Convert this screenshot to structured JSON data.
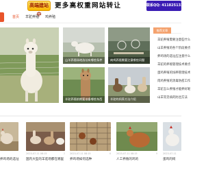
{
  "banner": {
    "tag": "高端建站中",
    "slogan": "更多高权重网站转让",
    "qq": "联系QQ: 411825133"
  },
  "nav": {
    "items": [
      "首页",
      "羊驼养殖",
      "鸡养殖"
    ],
    "active_index": 0
  },
  "featured": {
    "tiles": [
      {
        "caption": "山羊养殖场地选址有哪些条件"
      },
      {
        "caption": "肉鸡养殖需要注意哪些问题"
      },
      {
        "caption": "羊驼养殖前期要准备哪些东西"
      },
      {
        "caption": "羊驼的饲养方法介绍"
      }
    ]
  },
  "sidebar": {
    "heading": "推荐文章",
    "items": [
      "羊驼养殖需要注意些什么",
      "山羊养殖的各个阶段要点",
      "养鸡场的选址应注意什么",
      "羊驼的养殖管理技术要点",
      "蛋鸡养殖的饲养管理技术",
      "肉鸡养殖的消毒防疫工作",
      "羊驼怎么养殖才能养好呢",
      "山羊常见病的防治方法"
    ]
  },
  "cards": [
    {
      "date": "",
      "title": "养鸡场的选址",
      "more": ""
    },
    {
      "date": "2023-07-11 08:15",
      "title": "国内大型的羊驼场都在哪里",
      "more": "2"
    },
    {
      "date": "2023-07-11 08:15",
      "title": "养鸡场如何选种",
      "more": "6"
    },
    {
      "date": "2023-07-11 08:15",
      "title": "人工养殖的鸡的",
      "more": "9"
    },
    {
      "date": "2023-07-11",
      "title": "蛋鸡的饲",
      "more": ""
    }
  ],
  "colors": {
    "accent": "#e8542a",
    "banner_tag_bg": "#f8b400",
    "banner_qq_bg": "#3a1cb4",
    "sidebar_head": "#f4a26e"
  }
}
